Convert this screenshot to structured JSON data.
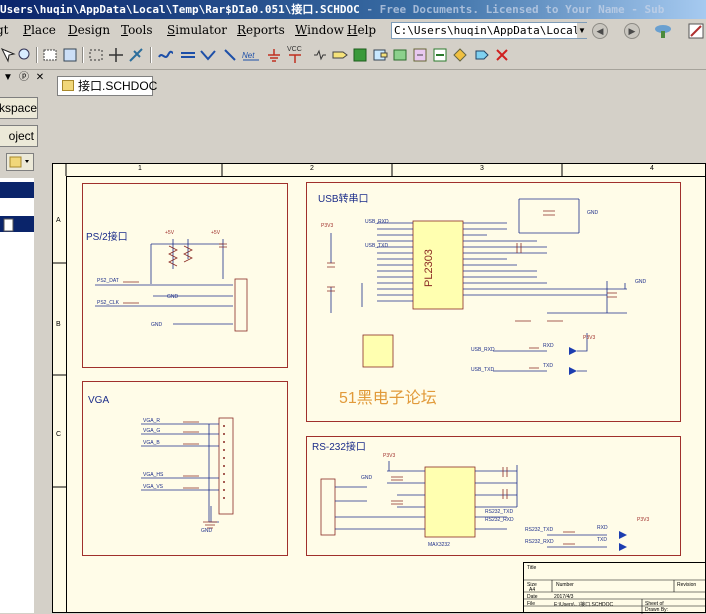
{
  "window": {
    "title": "Users\\huqin\\AppData\\Local\\Temp\\Rar$DIa0.051\\接口.SCHDOC",
    "watermark": " - Free Documents. Licensed to Your Name - Sub"
  },
  "menu": {
    "items": [
      {
        "label": "gt",
        "accel": ""
      },
      {
        "label": "Place",
        "accel": "P"
      },
      {
        "label": "Design",
        "accel": "D"
      },
      {
        "label": "Tools",
        "accel": "T"
      },
      {
        "label": "Simulator",
        "accel": "S"
      },
      {
        "label": "Reports",
        "accel": "R"
      },
      {
        "label": "Window",
        "accel": "W"
      },
      {
        "label": "Help",
        "accel": "H"
      }
    ],
    "path_value": "C:\\Users\\huqin\\AppData\\Local\\Te"
  },
  "toolbar": {
    "icons": [
      "wire-icon",
      "bus-icon",
      "signal-harness-icon",
      "bus-entry-icon",
      "net-label-icon",
      "gnd-power-icon",
      "vcc-power-icon",
      "part-icon",
      "sheet-symbol-icon",
      "sheet-entry-icon",
      "device-sheet-icon",
      "port-icon",
      "no-erc-icon"
    ]
  },
  "panel": {
    "workspace_label": "kspace",
    "project_label": "oject"
  },
  "document": {
    "tab_label": "接口.SCHDOC"
  },
  "schematic": {
    "ps2_title": "PS/2接口",
    "usb_title": "USB转串口",
    "vga_title": "VGA",
    "rs232_title": "RS-232接口",
    "watermark": "51黑电子论坛",
    "chip_pl2303": "PL2303",
    "chip_max": "MAX3232",
    "net_labels": {
      "ps2_dat": "PS2_DAT",
      "ps2_clk": "PS2_CLK",
      "usb_rxd": "USB_RXD",
      "usb_txd": "USB_TXD",
      "rxd": "RXD",
      "txd": "TXD",
      "vga_r": "VGA_R",
      "vga_g": "VGA_G",
      "vga_b": "VGA_B",
      "vga_hs": "VGA_HS",
      "vga_vs": "VGA_VS",
      "rs232_txd": "RS232_TXD",
      "rs232_rxd": "RS232_RXD",
      "gnd": "GND",
      "plus5v": "+5V",
      "p3v3": "P3V3"
    },
    "ruler_numbers": [
      "1",
      "2",
      "3",
      "4"
    ],
    "ruler_letters": [
      "A",
      "B",
      "C"
    ],
    "titleblock": {
      "title": "Title",
      "size": "Size",
      "size_value": "A4",
      "number": "Number",
      "revision": "Revision",
      "date": "Date",
      "date_value": "2017/4/3",
      "sheet_of": "Sheet of",
      "file": "File",
      "file_value": "E:\\Users\\...\\接口.SCHDOC",
      "drawn_by": "Drawn By:"
    }
  },
  "colors": {
    "box_border": "#a0302c",
    "wire": "#1c2d8a",
    "component": "#8a2a24",
    "chip_fill": "#ffffb0",
    "sheet_bg": "#fffce8"
  }
}
